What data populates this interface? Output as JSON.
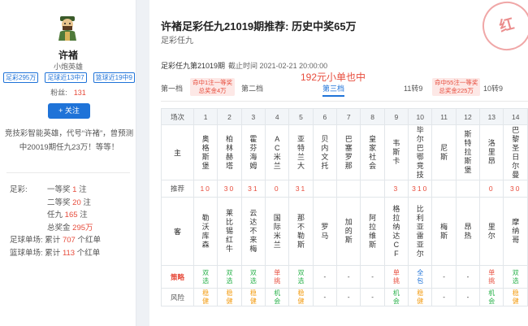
{
  "profile": {
    "name": "许褚",
    "title": "小炮英雄",
    "tags": [
      "足彩295万",
      "足球近13中7",
      "篮球近19中9"
    ],
    "fans_label": "粉丝:",
    "fans_count": "131",
    "follow_label": "+ 关注",
    "intro": "竞技彩智能英雄，代号“许褚”，曾预测中20019期任九23万！等等！"
  },
  "stats": {
    "zucai_label": "足彩:",
    "rows": [
      {
        "label": "一等奖",
        "value": "1",
        "unit": "注"
      },
      {
        "label": "二等奖",
        "value": "20",
        "unit": "注"
      },
      {
        "label": "任九",
        "value": "165",
        "unit": "注"
      },
      {
        "label": "总奖金",
        "value": "295万",
        "unit": ""
      }
    ],
    "football": {
      "label": "足球单场:",
      "prefix": "累计",
      "value": "707",
      "unit": "个红单"
    },
    "basketball": {
      "label": "篮球单场:",
      "prefix": "累计",
      "value": "113",
      "unit": "个红单"
    }
  },
  "article": {
    "title": "许褚足彩任九21019期推荐: 历史中奖65万",
    "subtitle": "足彩任九",
    "stamp": "红",
    "period": "足彩任九第21019期",
    "deadline": "截止时间 2021-02-21 20:00:00",
    "prize_highlight": "192元小单也中"
  },
  "tiers": {
    "items": [
      "第一档",
      "第二档",
      "第三档",
      "11转9",
      "10转9"
    ],
    "badge1_line1": "命中1注一等奖",
    "badge1_line2": "总奖金4万",
    "badge2_line1": "命中55注一等奖",
    "badge2_line2": "总奖金225万"
  },
  "table": {
    "labels": {
      "seq": "场次",
      "home": "主",
      "rec": "推荐",
      "away": "客",
      "strategy": "策略",
      "risk": "风险"
    },
    "seq": [
      "1",
      "2",
      "3",
      "4",
      "5",
      "6",
      "7",
      "8",
      "9",
      "10",
      "11",
      "12",
      "13",
      "14"
    ],
    "home": [
      "奥格斯堡",
      "柏林赫塔",
      "霍芬海姆",
      "AC米兰",
      "亚特兰大",
      "贝内文托",
      "巴塞罗那",
      "皇家社会",
      "韦斯卡",
      "毕尔巴鄂竞技",
      "尼斯",
      "斯特拉斯堡",
      "洛里昂",
      "巴黎圣日尔曼"
    ],
    "rec": [
      "10",
      "30",
      "31",
      "0",
      "31",
      "",
      "",
      "",
      "3",
      "310",
      "",
      "",
      "0",
      "30"
    ],
    "away": [
      "勒沃库森",
      "莱比锡红牛",
      "云达不来梅",
      "国际米兰",
      "那不勒斯",
      "罗马",
      "加的斯",
      "阿拉维斯",
      "格拉纳达CF",
      "比利亚雷亚尔",
      "梅斯",
      "昂热",
      "里尔",
      "摩纳哥"
    ],
    "strategy": [
      "双选",
      "双选",
      "双选",
      "单挑",
      "双选",
      "-",
      "-",
      "-",
      "单挑",
      "全包",
      "-",
      "-",
      "单挑",
      "双选"
    ],
    "risk": [
      "稳健",
      "稳健",
      "稳健",
      "机会",
      "稳健",
      "-",
      "-",
      "-",
      "机会",
      "稳健",
      "-",
      "-",
      "机会",
      "稳健"
    ]
  },
  "colors": {
    "accent": "#1f73d8",
    "red": "#e74c3c",
    "green": "#2bb24c",
    "orange": "#f39c12"
  }
}
